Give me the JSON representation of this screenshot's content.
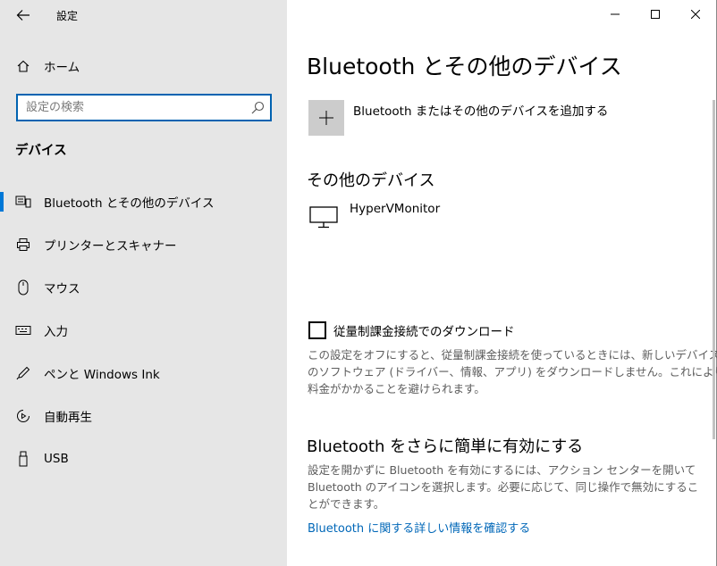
{
  "window": {
    "title": "設定",
    "controls": {
      "minimize": "—",
      "maximize": "☐",
      "close": "✕"
    }
  },
  "sidebar": {
    "home_label": "ホーム",
    "search": {
      "placeholder": "設定の検索",
      "value": ""
    },
    "section_heading": "デバイス",
    "items": [
      {
        "label": "Bluetooth とその他のデバイス",
        "icon": "bluetooth-devices-icon",
        "selected": true
      },
      {
        "label": "プリンターとスキャナー",
        "icon": "printer-icon",
        "selected": false
      },
      {
        "label": "マウス",
        "icon": "mouse-icon",
        "selected": false
      },
      {
        "label": "入力",
        "icon": "keyboard-icon",
        "selected": false
      },
      {
        "label": "ペンと Windows Ink",
        "icon": "pen-icon",
        "selected": false
      },
      {
        "label": "自動再生",
        "icon": "autoplay-icon",
        "selected": false
      },
      {
        "label": "USB",
        "icon": "usb-icon",
        "selected": false
      }
    ]
  },
  "main": {
    "title": "Bluetooth とその他のデバイス",
    "add_device_label": "Bluetooth またはその他のデバイスを追加する",
    "other_devices_heading": "その他のデバイス",
    "devices": [
      {
        "name": "HyperVMonitor",
        "icon": "monitor-icon"
      }
    ],
    "metered": {
      "checkbox_label": "従量制課金接続でのダウンロード",
      "checked": false,
      "description_lines": [
        "この設定をオフにすると、従量制課金接続を使っているときには、新しいデバイス",
        "のソフトウェア (ドライバー、情報、アプリ) をダウンロードしません。これにより追加",
        "料金がかかることを避けられます。"
      ]
    },
    "quick": {
      "heading": "Bluetooth をさらに簡単に有効にする",
      "description_lines": [
        "設定を開かずに Bluetooth を有効にするには、アクション センターを開いて",
        "Bluetooth のアイコンを選択します。必要に応じて、同じ操作で無効にするこ",
        "とができます。"
      ],
      "link": "Bluetooth に関する詳しい情報を確認する"
    }
  },
  "colors": {
    "accent": "#0078d7",
    "link": "#0067b8",
    "sidebar_bg": "#e6e6e6"
  }
}
